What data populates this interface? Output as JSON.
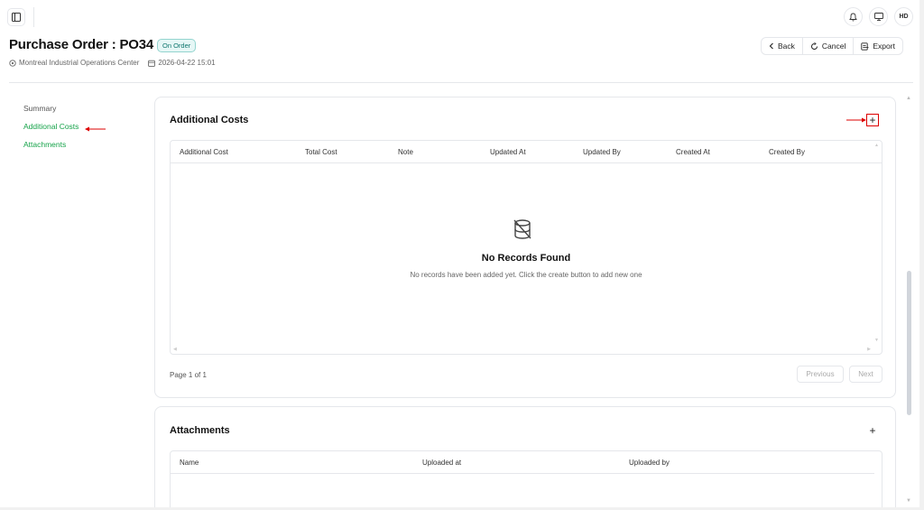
{
  "topbar": {
    "avatar_initials": "HD"
  },
  "header": {
    "title": "Purchase Order : PO34",
    "status": "On Order",
    "location": "Montreal Industrial Operations Center",
    "datetime": "2026-04-22 15:01",
    "actions": {
      "back": "Back",
      "cancel": "Cancel",
      "export": "Export"
    }
  },
  "nav": {
    "items": [
      {
        "label": "Summary"
      },
      {
        "label": "Additional Costs"
      },
      {
        "label": "Attachments"
      }
    ]
  },
  "additional_costs": {
    "title": "Additional Costs",
    "add_label": "+",
    "columns": [
      "Additional Cost",
      "Total Cost",
      "Note",
      "Updated At",
      "Updated By",
      "Created At",
      "Created By"
    ],
    "empty_title": "No Records Found",
    "empty_desc": "No records have been added yet. Click the create button to add new one",
    "pagination": {
      "text": "Page 1 of 1",
      "previous": "Previous",
      "next": "Next"
    }
  },
  "attachments": {
    "title": "Attachments",
    "add_label": "+",
    "columns": [
      "Name",
      "Uploaded at",
      "Uploaded by"
    ]
  },
  "colors": {
    "accent_green": "#16a34a",
    "annotation_red": "#dd0000"
  }
}
